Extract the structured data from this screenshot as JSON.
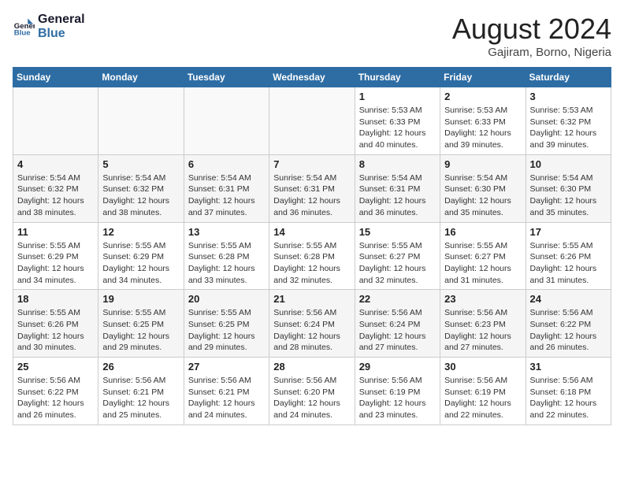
{
  "header": {
    "logo_line1": "General",
    "logo_line2": "Blue",
    "month_year": "August 2024",
    "location": "Gajiram, Borno, Nigeria"
  },
  "weekdays": [
    "Sunday",
    "Monday",
    "Tuesday",
    "Wednesday",
    "Thursday",
    "Friday",
    "Saturday"
  ],
  "weeks": [
    [
      {
        "day": "",
        "info": ""
      },
      {
        "day": "",
        "info": ""
      },
      {
        "day": "",
        "info": ""
      },
      {
        "day": "",
        "info": ""
      },
      {
        "day": "1",
        "info": "Sunrise: 5:53 AM\nSunset: 6:33 PM\nDaylight: 12 hours\nand 40 minutes."
      },
      {
        "day": "2",
        "info": "Sunrise: 5:53 AM\nSunset: 6:33 PM\nDaylight: 12 hours\nand 39 minutes."
      },
      {
        "day": "3",
        "info": "Sunrise: 5:53 AM\nSunset: 6:32 PM\nDaylight: 12 hours\nand 39 minutes."
      }
    ],
    [
      {
        "day": "4",
        "info": "Sunrise: 5:54 AM\nSunset: 6:32 PM\nDaylight: 12 hours\nand 38 minutes."
      },
      {
        "day": "5",
        "info": "Sunrise: 5:54 AM\nSunset: 6:32 PM\nDaylight: 12 hours\nand 38 minutes."
      },
      {
        "day": "6",
        "info": "Sunrise: 5:54 AM\nSunset: 6:31 PM\nDaylight: 12 hours\nand 37 minutes."
      },
      {
        "day": "7",
        "info": "Sunrise: 5:54 AM\nSunset: 6:31 PM\nDaylight: 12 hours\nand 36 minutes."
      },
      {
        "day": "8",
        "info": "Sunrise: 5:54 AM\nSunset: 6:31 PM\nDaylight: 12 hours\nand 36 minutes."
      },
      {
        "day": "9",
        "info": "Sunrise: 5:54 AM\nSunset: 6:30 PM\nDaylight: 12 hours\nand 35 minutes."
      },
      {
        "day": "10",
        "info": "Sunrise: 5:54 AM\nSunset: 6:30 PM\nDaylight: 12 hours\nand 35 minutes."
      }
    ],
    [
      {
        "day": "11",
        "info": "Sunrise: 5:55 AM\nSunset: 6:29 PM\nDaylight: 12 hours\nand 34 minutes."
      },
      {
        "day": "12",
        "info": "Sunrise: 5:55 AM\nSunset: 6:29 PM\nDaylight: 12 hours\nand 34 minutes."
      },
      {
        "day": "13",
        "info": "Sunrise: 5:55 AM\nSunset: 6:28 PM\nDaylight: 12 hours\nand 33 minutes."
      },
      {
        "day": "14",
        "info": "Sunrise: 5:55 AM\nSunset: 6:28 PM\nDaylight: 12 hours\nand 32 minutes."
      },
      {
        "day": "15",
        "info": "Sunrise: 5:55 AM\nSunset: 6:27 PM\nDaylight: 12 hours\nand 32 minutes."
      },
      {
        "day": "16",
        "info": "Sunrise: 5:55 AM\nSunset: 6:27 PM\nDaylight: 12 hours\nand 31 minutes."
      },
      {
        "day": "17",
        "info": "Sunrise: 5:55 AM\nSunset: 6:26 PM\nDaylight: 12 hours\nand 31 minutes."
      }
    ],
    [
      {
        "day": "18",
        "info": "Sunrise: 5:55 AM\nSunset: 6:26 PM\nDaylight: 12 hours\nand 30 minutes."
      },
      {
        "day": "19",
        "info": "Sunrise: 5:55 AM\nSunset: 6:25 PM\nDaylight: 12 hours\nand 29 minutes."
      },
      {
        "day": "20",
        "info": "Sunrise: 5:55 AM\nSunset: 6:25 PM\nDaylight: 12 hours\nand 29 minutes."
      },
      {
        "day": "21",
        "info": "Sunrise: 5:56 AM\nSunset: 6:24 PM\nDaylight: 12 hours\nand 28 minutes."
      },
      {
        "day": "22",
        "info": "Sunrise: 5:56 AM\nSunset: 6:24 PM\nDaylight: 12 hours\nand 27 minutes."
      },
      {
        "day": "23",
        "info": "Sunrise: 5:56 AM\nSunset: 6:23 PM\nDaylight: 12 hours\nand 27 minutes."
      },
      {
        "day": "24",
        "info": "Sunrise: 5:56 AM\nSunset: 6:22 PM\nDaylight: 12 hours\nand 26 minutes."
      }
    ],
    [
      {
        "day": "25",
        "info": "Sunrise: 5:56 AM\nSunset: 6:22 PM\nDaylight: 12 hours\nand 26 minutes."
      },
      {
        "day": "26",
        "info": "Sunrise: 5:56 AM\nSunset: 6:21 PM\nDaylight: 12 hours\nand 25 minutes."
      },
      {
        "day": "27",
        "info": "Sunrise: 5:56 AM\nSunset: 6:21 PM\nDaylight: 12 hours\nand 24 minutes."
      },
      {
        "day": "28",
        "info": "Sunrise: 5:56 AM\nSunset: 6:20 PM\nDaylight: 12 hours\nand 24 minutes."
      },
      {
        "day": "29",
        "info": "Sunrise: 5:56 AM\nSunset: 6:19 PM\nDaylight: 12 hours\nand 23 minutes."
      },
      {
        "day": "30",
        "info": "Sunrise: 5:56 AM\nSunset: 6:19 PM\nDaylight: 12 hours\nand 22 minutes."
      },
      {
        "day": "31",
        "info": "Sunrise: 5:56 AM\nSunset: 6:18 PM\nDaylight: 12 hours\nand 22 minutes."
      }
    ]
  ]
}
